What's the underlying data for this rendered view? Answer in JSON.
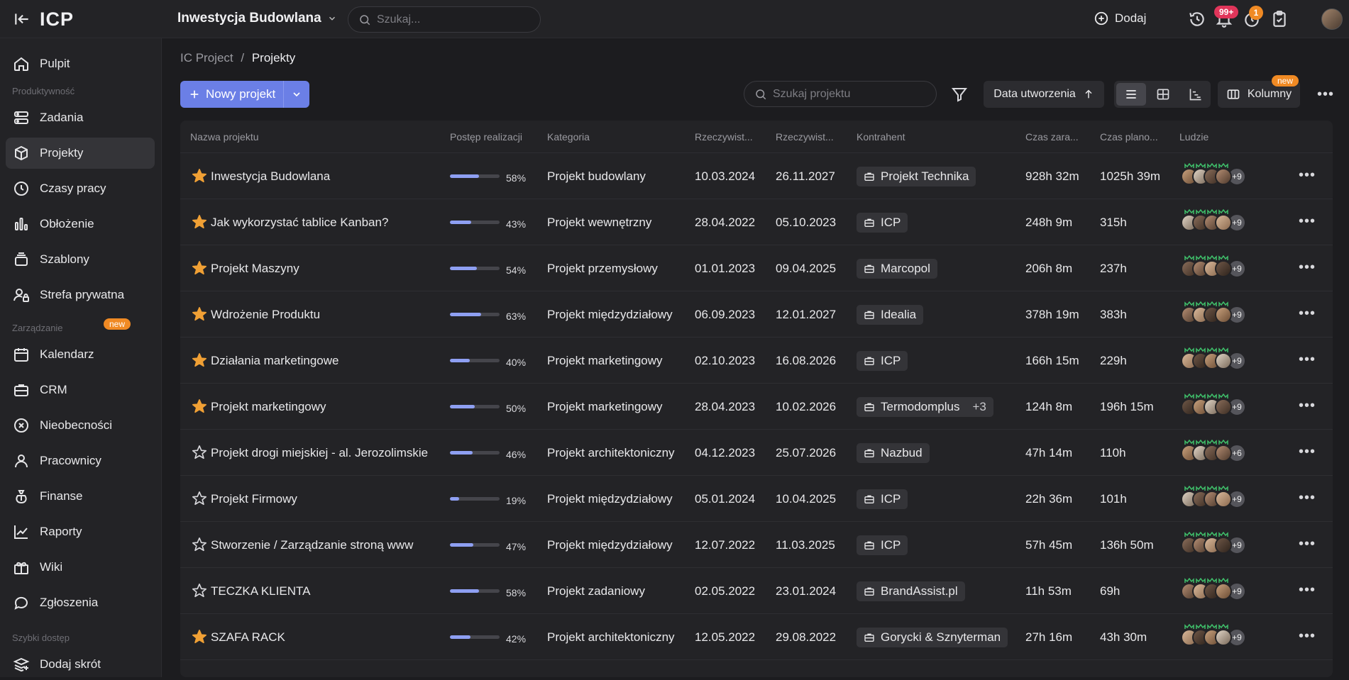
{
  "topbar": {
    "logo": "ICP",
    "project_title": "Inwestycja Budowlana",
    "search_placeholder": "Szukaj...",
    "add_label": "Dodaj",
    "notifications_badge": "99+",
    "timer_badge": "1"
  },
  "sidebar": {
    "dashboard": "Pulpit",
    "section_productivity": "Produktywność",
    "tasks": "Zadania",
    "projects": "Projekty",
    "worktime": "Czasy pracy",
    "workload": "Obłożenie",
    "templates": "Szablony",
    "private_zone": "Strefa prywatna",
    "new_badge": "new",
    "section_management": "Zarządzanie",
    "calendar": "Kalendarz",
    "crm": "CRM",
    "absences": "Nieobecności",
    "employees": "Pracownicy",
    "finances": "Finanse",
    "reports": "Raporty",
    "wiki": "Wiki",
    "tickets": "Zgłoszenia",
    "section_quick": "Szybki dostęp",
    "add_shortcut": "Dodaj skrót"
  },
  "toolbar": {
    "crumb_root": "IC Project",
    "crumb_sep": "/",
    "crumb_current": "Projekty",
    "new_project": "Nowy projekt",
    "search_placeholder": "Szukaj projektu",
    "sort_label": "Data utworzenia",
    "columns_label": "Kolumny",
    "columns_badge": "new"
  },
  "table": {
    "headers": {
      "name": "Nazwa projektu",
      "progress": "Postęp realizacji",
      "category": "Kategoria",
      "start": "Rzeczywist...",
      "end": "Rzeczywist...",
      "client": "Kontrahent",
      "time_spent": "Czas zara...",
      "time_planned": "Czas plano...",
      "people": "Ludzie"
    },
    "rows": [
      {
        "starred": true,
        "name": "Inwestycja Budowlana",
        "progress": 58,
        "progress_label": "58%",
        "category": "Projekt budowlany",
        "start": "10.03.2024",
        "end": "26.11.2027",
        "client": "Projekt Technika",
        "client_extra": "",
        "time_spent": "928h 32m",
        "time_planned": "1025h 39m",
        "people_more": "+9"
      },
      {
        "starred": true,
        "name": "Jak wykorzystać tablice Kanban?",
        "progress": 43,
        "progress_label": "43%",
        "category": "Projekt wewnętrzny",
        "start": "28.04.2022",
        "end": "05.10.2023",
        "client": "ICP",
        "client_extra": "",
        "time_spent": "248h 9m",
        "time_planned": "315h",
        "people_more": "+9"
      },
      {
        "starred": true,
        "name": "Projekt Maszyny",
        "progress": 54,
        "progress_label": "54%",
        "category": "Projekt przemysłowy",
        "start": "01.01.2023",
        "end": "09.04.2025",
        "client": "Marcopol",
        "client_extra": "",
        "time_spent": "206h 8m",
        "time_planned": "237h",
        "people_more": "+9"
      },
      {
        "starred": true,
        "name": "Wdrożenie Produktu",
        "progress": 63,
        "progress_label": "63%",
        "category": "Projekt międzydziałowy",
        "start": "06.09.2023",
        "end": "12.01.2027",
        "client": "Idealia",
        "client_extra": "",
        "time_spent": "378h 19m",
        "time_planned": "383h",
        "people_more": "+9"
      },
      {
        "starred": true,
        "name": "Działania marketingowe",
        "progress": 40,
        "progress_label": "40%",
        "category": "Projekt marketingowy",
        "start": "02.10.2023",
        "end": "16.08.2026",
        "client": "ICP",
        "client_extra": "",
        "time_spent": "166h 15m",
        "time_planned": "229h",
        "people_more": "+9"
      },
      {
        "starred": true,
        "name": "Projekt marketingowy",
        "progress": 50,
        "progress_label": "50%",
        "category": "Projekt marketingowy",
        "start": "28.04.2023",
        "end": "10.02.2026",
        "client": "Termodomplus",
        "client_extra": "+3",
        "time_spent": "124h 8m",
        "time_planned": "196h 15m",
        "people_more": "+9"
      },
      {
        "starred": false,
        "name": "Projekt drogi miejskiej - al. Jerozolimskie",
        "progress": 46,
        "progress_label": "46%",
        "category": "Projekt architektoniczny",
        "start": "04.12.2023",
        "end": "25.07.2026",
        "client": "Nazbud",
        "client_extra": "",
        "time_spent": "47h 14m",
        "time_planned": "110h",
        "people_more": "+6"
      },
      {
        "starred": false,
        "name": "Projekt Firmowy",
        "progress": 19,
        "progress_label": "19%",
        "category": "Projekt międzydziałowy",
        "start": "05.01.2024",
        "end": "10.04.2025",
        "client": "ICP",
        "client_extra": "",
        "time_spent": "22h 36m",
        "time_planned": "101h",
        "people_more": "+9"
      },
      {
        "starred": false,
        "name": "Stworzenie / Zarządzanie stroną www",
        "progress": 47,
        "progress_label": "47%",
        "category": "Projekt międzydziałowy",
        "start": "12.07.2022",
        "end": "11.03.2025",
        "client": "ICP",
        "client_extra": "",
        "time_spent": "57h 45m",
        "time_planned": "136h 50m",
        "people_more": "+9"
      },
      {
        "starred": false,
        "name": "TECZKA KLIENTA",
        "progress": 58,
        "progress_label": "58%",
        "category": "Projekt zadaniowy",
        "start": "02.05.2022",
        "end": "23.01.2024",
        "client": "BrandAssist.pl",
        "client_extra": "",
        "time_spent": "11h 53m",
        "time_planned": "69h",
        "people_more": "+9"
      },
      {
        "starred": true,
        "name": "SZAFA RACK",
        "progress": 42,
        "progress_label": "42%",
        "category": "Projekt architektoniczny",
        "start": "12.05.2022",
        "end": "29.08.2022",
        "client": "Gorycki & Sznyterman",
        "client_extra": "",
        "time_spent": "27h 16m",
        "time_planned": "43h 30m",
        "people_more": "+9"
      }
    ]
  },
  "colors": {
    "accent": "#6b7fe6",
    "star": "#f0a035",
    "badge_red": "#e0355a",
    "badge_orange": "#f08a24",
    "crown": "#3fbf6a"
  }
}
